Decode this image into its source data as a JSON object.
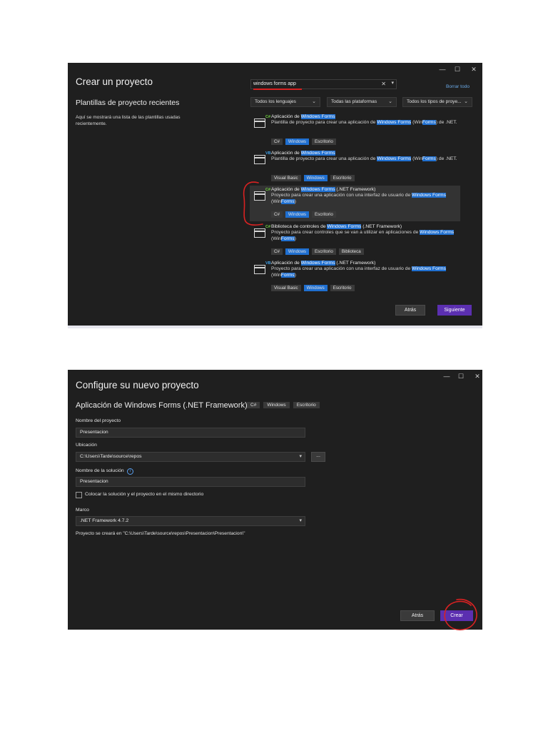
{
  "window1": {
    "title": "Crear un proyecto",
    "subtitle": "Plantillas de proyecto recientes",
    "recent_note": "Aquí se mostrará una lista de las plantillas usadas recientemente.",
    "window_controls": [
      "—",
      "☐",
      "✕"
    ],
    "search": {
      "value": "windows forms app",
      "clear": "✕",
      "dropdown": "▾"
    },
    "clear_all": "Borrar todo",
    "filters": [
      "Todos los lenguajes",
      "Todas las plataformas",
      "Todos los tipos de proye..."
    ],
    "templates": [
      {
        "badge": "C#",
        "name_pre": "Aplicación de ",
        "name_hl": "Windows Forms",
        "name_post": "",
        "desc_a": "Plantilla de proyecto para crear una aplicación de ",
        "desc_hl": "Windows Forms",
        "desc_b": " (Win",
        "desc_hl2": "Forms",
        "desc_c": ") de .NET.",
        "tags": [
          "C#",
          "Windows",
          "Escritorio"
        ]
      },
      {
        "badge": "VB",
        "name_pre": "Aplicación de ",
        "name_hl": "Windows Forms",
        "name_post": "",
        "desc_a": "Plantilla de proyecto para crear una aplicación de ",
        "desc_hl": "Windows Forms",
        "desc_b": " (Win",
        "desc_hl2": "Forms",
        "desc_c": ") de .NET.",
        "tags": [
          "Visual Basic",
          "Windows",
          "Escritorio"
        ]
      },
      {
        "badge": "C#",
        "name_pre": "Aplicación de ",
        "name_hl": "Windows Forms",
        "name_post": " (.NET Framework)",
        "desc_a": "Proyecto para crear una aplicación con una interfaz de usuario de ",
        "desc_hl": "Windows Forms",
        "desc_b": " (Win",
        "desc_hl2": "Forms",
        "desc_c": ")",
        "tags": [
          "C#",
          "Windows",
          "Escritorio"
        ]
      },
      {
        "badge": "C#",
        "name_pre": "Biblioteca de controles de ",
        "name_hl": "Windows Forms",
        "name_post": " (.NET Framework)",
        "desc_a": "Proyecto para crear controles que se van a utilizar en aplicaciones de ",
        "desc_hl": "Windows Forms",
        "desc_b": " (Win",
        "desc_hl2": "Forms",
        "desc_c": ")",
        "tags": [
          "C#",
          "Windows",
          "Escritorio",
          "Biblioteca"
        ]
      },
      {
        "badge": "VB",
        "name_pre": "Aplicación de ",
        "name_hl": "Windows Forms",
        "name_post": " (.NET Framework)",
        "desc_a": "Proyecto para crear una aplicación con una interfaz de usuario de ",
        "desc_hl": "Windows Forms",
        "desc_b": " (Win",
        "desc_hl2": "Forms",
        "desc_c": ")",
        "tags": [
          "Visual Basic",
          "Windows",
          "Escritorio"
        ]
      }
    ],
    "back": "Atrás",
    "next": "Siguiente"
  },
  "window2": {
    "title": "Configure su nuevo proyecto",
    "template_name": "Aplicación de Windows Forms (.NET Framework)",
    "tags": [
      "C#",
      "Windows",
      "Escritorio"
    ],
    "window_controls": [
      "—",
      "☐",
      "✕"
    ],
    "project_name_label": "Nombre del proyecto",
    "project_name": "Presentacion",
    "location_label": "Ubicación",
    "location": "C:\\Users\\Tarde\\source\\repos",
    "browse": "...",
    "solution_label": "Nombre de la solución",
    "solution_name": "Presentacion",
    "same_dir_label": "Colocar la solución y el proyecto en el mismo directorio",
    "framework_label": "Marco",
    "framework": ".NET Framework 4.7.2",
    "path_note": "Proyecto se creará en \"C:\\Users\\Tarde\\source\\repos\\Presentacion\\Presentacion\\\"",
    "back": "Atrás",
    "create": "Crear"
  },
  "colors": {
    "window_bg": "#1f1f1f",
    "highlight": "#1f6fd0",
    "primary_button": "#5b2fb0",
    "annotation": "#d82222",
    "badge_csharp": "#6fcf3f",
    "badge_vb": "#3fa0e8"
  }
}
